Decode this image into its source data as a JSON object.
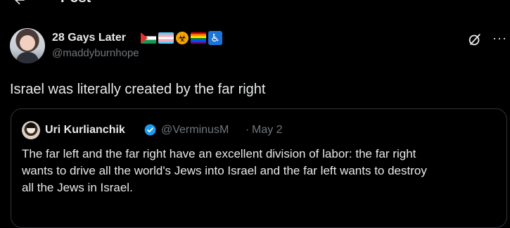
{
  "header": {
    "title": "Post"
  },
  "post": {
    "display_name": "28 Gays Later",
    "handle": "@maddyburnhope",
    "text": "Israel was literally created by the far right",
    "badges": [
      "palestine-flag-icon",
      "trans-flag-icon",
      "biohazard-icon",
      "rainbow-flag-icon",
      "wheelchair-icon"
    ]
  },
  "quote": {
    "display_name": "Uri Kurlianchik",
    "handle": "@VerminusM",
    "separator": "·",
    "date": "May 2",
    "lines": [
      "The far left and the far right have an excellent division of labor: the far right",
      "wants to drive all the world's Jews into Israel and the far left wants to destroy",
      "all the Jews in Israel."
    ]
  },
  "actions": {
    "more_label": "···"
  },
  "colors": {
    "background": "#000000",
    "text": "#e7e9ea",
    "muted": "#71767b",
    "border": "#2f3336",
    "verified": "#1d9bf0"
  }
}
